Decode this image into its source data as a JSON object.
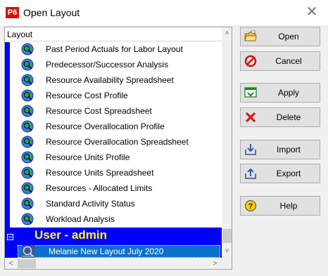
{
  "window": {
    "app_badge": "P6",
    "title": "Open Layout",
    "close_glyph": "✕"
  },
  "tree": {
    "header": "Layout",
    "items": [
      {
        "label": "Past Period Actuals for Labor Layout",
        "icon": "layout-globe-icon"
      },
      {
        "label": "Predecessor/Successor Analysis",
        "icon": "layout-globe-icon"
      },
      {
        "label": "Resource Availability Spreadsheet",
        "icon": "layout-globe-icon"
      },
      {
        "label": "Resource Cost Profile",
        "icon": "layout-globe-icon"
      },
      {
        "label": "Resource Cost Spreadsheet",
        "icon": "layout-globe-icon"
      },
      {
        "label": "Resource Overallocation Profile",
        "icon": "layout-globe-icon"
      },
      {
        "label": "Resource Overallocation Spreadsheet",
        "icon": "layout-globe-icon"
      },
      {
        "label": "Resource Units Profile",
        "icon": "layout-globe-icon"
      },
      {
        "label": "Resource Units Spreadsheet",
        "icon": "layout-globe-icon"
      },
      {
        "label": "Resources - Allocated Limits",
        "icon": "layout-globe-icon"
      },
      {
        "label": "Standard Activity Status",
        "icon": "layout-globe-icon"
      },
      {
        "label": "Workload Analysis",
        "icon": "layout-globe-icon"
      }
    ],
    "group": {
      "label": "User - admin",
      "expanded": true
    },
    "selected_item": {
      "label": "Melanie New Layout July 2020",
      "icon": "user-layout-icon"
    }
  },
  "buttons": {
    "open": "Open",
    "cancel": "Cancel",
    "apply": "Apply",
    "delete": "Delete",
    "import": "Import",
    "export": "Export",
    "help": "Help"
  },
  "colors": {
    "group_band": "#0000ff",
    "group_text": "#ffff00",
    "selection": "#0a70cc",
    "app_badge": "#d1150e"
  }
}
